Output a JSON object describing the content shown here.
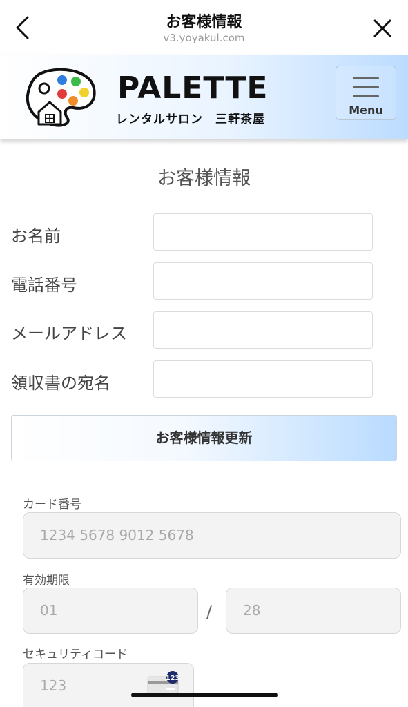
{
  "topbar": {
    "title": "お客様情報",
    "url": "v3.yoyakul.com"
  },
  "header": {
    "logo_name": "PALETTE",
    "logo_sub": "レンタルサロン　三軒茶屋",
    "menu_label": "Menu"
  },
  "form": {
    "title": "お客様情報",
    "fields": [
      {
        "label": "お名前",
        "value": ""
      },
      {
        "label": "電話番号",
        "value": ""
      },
      {
        "label": "メールアドレス",
        "value": ""
      },
      {
        "label": "領収書の宛名",
        "value": ""
      }
    ],
    "update_button": "お客様情報更新"
  },
  "card": {
    "number_label": "カード番号",
    "number_placeholder": "1234 5678 9012 5678",
    "expiry_label": "有効期限",
    "expiry_month_placeholder": "01",
    "expiry_separator": "/",
    "expiry_year_placeholder": "28",
    "cvv_label": "セキュリティコード",
    "cvv_placeholder": "123",
    "cvv_icon_text": "123"
  },
  "colors": {
    "header_gradient_end": "#bcdcff",
    "button_gradient_end": "#b9dbff",
    "cvv_badge": "#1f2a6b"
  }
}
